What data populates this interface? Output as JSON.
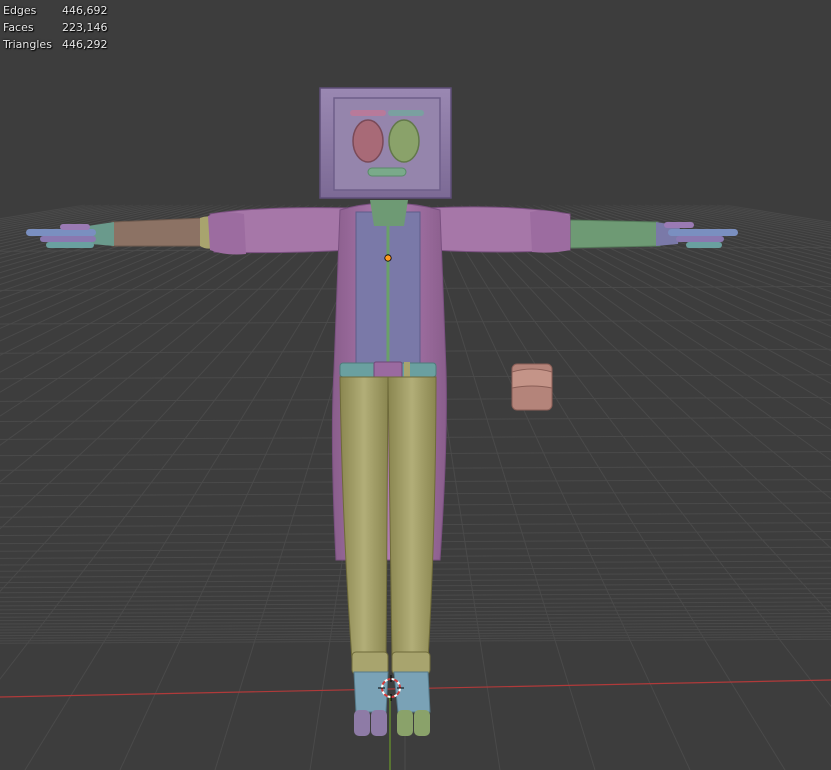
{
  "viewport": {
    "background_color": "#3d3d3d",
    "grid_line_color": "#4a4a4a",
    "x_axis_color": "#b03a3a",
    "y_axis_color": "#6a9a2a"
  },
  "statistics": [
    {
      "label": "Edges",
      "value": "446,692"
    },
    {
      "label": "Faces",
      "value": "223,146"
    },
    {
      "label": "Triangles",
      "value": "446,292"
    }
  ],
  "scene_objects": [
    {
      "name": "character-tv-head",
      "color": "#8e7ba6"
    },
    {
      "name": "screen-left-eye",
      "color": "#a86a77"
    },
    {
      "name": "screen-right-eye",
      "color": "#8aa26a"
    },
    {
      "name": "jacket",
      "color": "#a677a8"
    },
    {
      "name": "shirt",
      "color": "#7a79a8"
    },
    {
      "name": "pants",
      "color": "#a8a46e"
    },
    {
      "name": "belt",
      "color": "#6aa0a0"
    },
    {
      "name": "left-arm",
      "color": "#8c7264"
    },
    {
      "name": "right-arm",
      "color": "#6e9a74"
    },
    {
      "name": "shoes",
      "color": "#7aa2b6"
    },
    {
      "name": "satchel",
      "color": "#b4847a"
    }
  ],
  "cursor_3d": {
    "name": "3d-cursor-icon"
  }
}
